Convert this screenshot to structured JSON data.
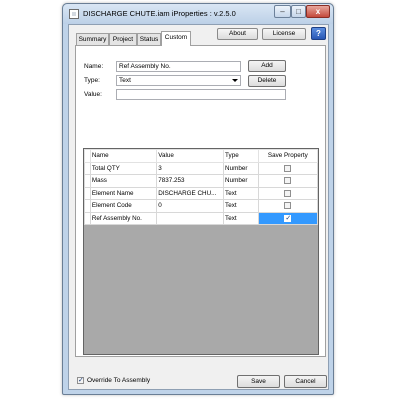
{
  "window": {
    "title": "DISCHARGE CHUTE.iam iProperties : v.2.5.0"
  },
  "tabs": [
    {
      "label": "Summary"
    },
    {
      "label": "Project"
    },
    {
      "label": "Status"
    },
    {
      "label": "Custom"
    }
  ],
  "header_buttons": {
    "about": "About",
    "license": "License",
    "help": "?"
  },
  "form": {
    "name_label": "Name:",
    "name_value": "Ref Assembly No.",
    "type_label": "Type:",
    "type_value": "Text",
    "value_label": "Value:",
    "value_value": "",
    "add_label": "Add",
    "delete_label": "Delete"
  },
  "grid": {
    "columns": [
      "Name",
      "Value",
      "Type",
      "Save Property"
    ],
    "rows": [
      {
        "name": "Total QTY",
        "value": "3",
        "type": "Number",
        "save": false
      },
      {
        "name": "Mass",
        "value": "7837.253",
        "type": "Number",
        "save": false
      },
      {
        "name": "Element Name",
        "value": "DISCHARGE CHU...",
        "type": "Text",
        "save": false
      },
      {
        "name": "Element Code",
        "value": "0",
        "type": "Text",
        "save": false
      },
      {
        "name": "Ref Assembly No.",
        "value": "",
        "type": "Text",
        "save": true
      }
    ]
  },
  "footer": {
    "override_label": "Override To Assembly",
    "override_checked": true,
    "save_label": "Save",
    "cancel_label": "Cancel"
  },
  "colors": {
    "selection": "#3399ff",
    "title_bar": "#bfd3e9",
    "close_button": "#c44a3c"
  }
}
